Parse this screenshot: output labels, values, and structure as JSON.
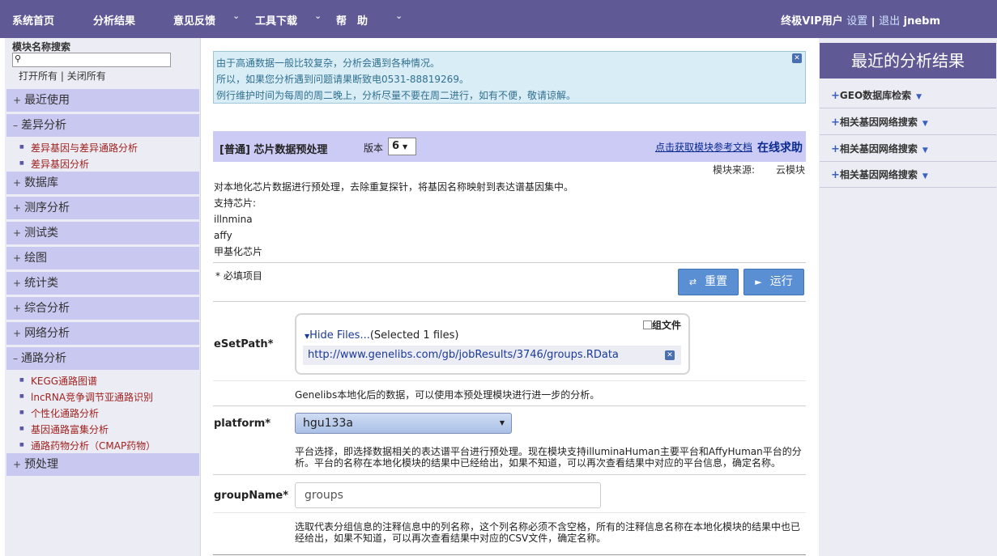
{
  "nav": {
    "items": [
      "系统首页",
      "分析结果",
      "意见反馈",
      "工具下载",
      "帮　助"
    ],
    "user_prefix": "终极VIP用户",
    "settings": "设置",
    "separator": "|",
    "logout": "退出",
    "username": "jnebm"
  },
  "sidebar": {
    "search_label": "模块名称搜索",
    "open_all": "打开所有",
    "close_all": "关闭所有",
    "groups": [
      {
        "sym": "+",
        "label": "最近使用"
      },
      {
        "sym": "–",
        "label": "差异分析"
      },
      {
        "sym": "+",
        "label": "数据库"
      },
      {
        "sym": "+",
        "label": "测序分析"
      },
      {
        "sym": "+",
        "label": "测试类"
      },
      {
        "sym": "+",
        "label": "绘图"
      },
      {
        "sym": "+",
        "label": "统计类"
      },
      {
        "sym": "+",
        "label": "综合分析"
      },
      {
        "sym": "+",
        "label": "网络分析"
      },
      {
        "sym": "–",
        "label": "通路分析"
      },
      {
        "sym": "+",
        "label": "预处理"
      }
    ],
    "diff_items": [
      "差异基因与差异通路分析",
      "差异基因分析"
    ],
    "pathway_items": [
      "KEGG通路图谱",
      "lncRNA竞争调节亚通路识别",
      "个性化通路分析",
      "基因通路富集分析",
      "通路药物分析（CMAP药物）"
    ]
  },
  "notice": {
    "lines": [
      "由于高通数据一般比较复杂，分析会遇到各种情况。",
      "所以，如果您分析遇到问题请果断致电0531-88819269。",
      "例行维护时间为每周的周二晚上，分析尽量不要在周二进行，如有不便，敬请谅解。"
    ]
  },
  "module": {
    "title": "[普通] 芯片数据预处理",
    "version_label": "版本",
    "version": "6",
    "doc_link": "点击获取模块参考文档",
    "help_link": "在线求助",
    "source_label": "模块来源:",
    "source_value": "云模块",
    "desc_lines": [
      "对本地化芯片数据进行预处理，去除重复探针，将基因名称映射到表达谱基因集中。",
      "支持芯片:",
      "illnmina",
      "affy",
      "甲基化芯片"
    ],
    "required_note": "* 必填项目",
    "reset_label": "重置",
    "run_label": "运行"
  },
  "form": {
    "esetpath": {
      "label": "eSetPath*",
      "group_files": "组文件",
      "hide_files": "Hide Files...",
      "selected": "(Selected 1 files)",
      "file_url": "http://www.genelibs.com/gb/jobResults/3746/groups.RData",
      "help": "Genelibs本地化后的数据，可以使用本预处理模块进行进一步的分析。"
    },
    "platform": {
      "label": "platform*",
      "value": "hgu133a",
      "help": "平台选择，即选择数据相关的表达谱平台进行预处理。现在模块支持illuminaHuman主要平台和AffyHuman平台的分析。平台的名称在本地化模块的结果中已经给出，如果不知道，可以再次查看结果中对应的平台信息，确定名称。"
    },
    "groupname": {
      "label": "groupName*",
      "value": "groups",
      "help": "选取代表分组信息的注释信息中的列名称，这个列名称必须不含空格，所有的注释信息名称在本地化模块的结果中也已经给出，如果不知道，可以再次查看结果中对应的CSV文件，确定名称。"
    }
  },
  "right_panel": {
    "title": "最近的分析结果",
    "items": [
      "GEO数据库检索",
      "相关基因网络搜索",
      "相关基因网络搜索",
      "相关基因网络搜索"
    ]
  },
  "colors": {
    "nav_bg": "#5f5a96",
    "sidebar_group_bg": "#c8c8f0",
    "notice_bg": "#d9edf7",
    "button_bg": "#5b8fd3"
  }
}
